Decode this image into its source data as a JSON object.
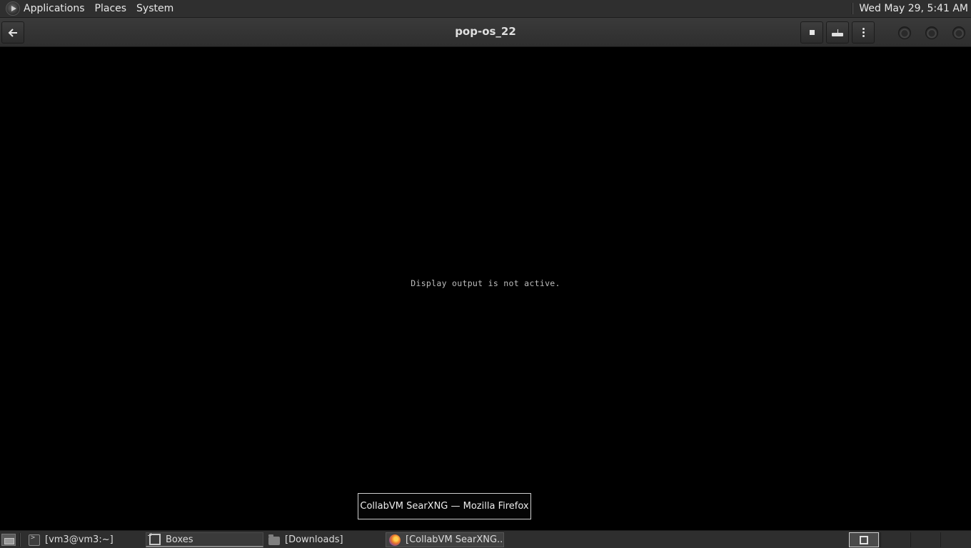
{
  "top_panel": {
    "menus": [
      "Applications",
      "Places",
      "System"
    ],
    "clock": "Wed May 29,  5:41 AM"
  },
  "header_bar": {
    "title": "pop-os_22",
    "buttons": {
      "back": "back-arrow-icon",
      "stop": "stop-icon",
      "send_keys": "keyboard-icon",
      "menu": "vertical-dots-icon"
    }
  },
  "vm_display": {
    "message": "Display output is not active."
  },
  "tooltip": {
    "text": "CollabVM SearXNG — Mozilla Firefox"
  },
  "taskbar": {
    "tasks": [
      {
        "label": "[vm3@vm3:~]",
        "icon": "terminal-icon",
        "active": false
      },
      {
        "label": "Boxes",
        "icon": "boxes-icon",
        "active": true
      },
      {
        "label": "[Downloads]",
        "icon": "folder-icon",
        "active": false
      },
      {
        "label": "[CollabVM SearXNG...",
        "icon": "firefox-icon",
        "hovered": true
      }
    ]
  },
  "colors": {
    "panel": "#2f2f2f",
    "header": "#333333",
    "display": "#000000",
    "text": "#e6e6e6"
  }
}
